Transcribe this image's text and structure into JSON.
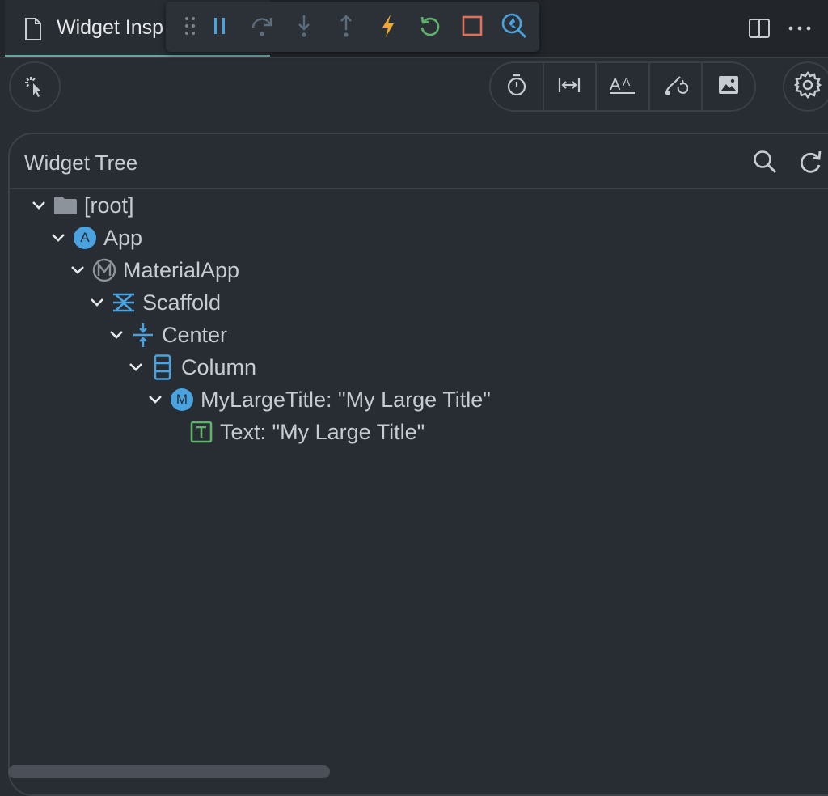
{
  "tab": {
    "label": "Widget Insp"
  },
  "panel": {
    "title": "Widget Tree"
  },
  "tree": [
    {
      "label": "[root]",
      "icon": "folder-icon"
    },
    {
      "label": "App",
      "icon": "app-badge-icon",
      "badge": "A"
    },
    {
      "label": "MaterialApp",
      "icon": "material-app-icon"
    },
    {
      "label": "Scaffold",
      "icon": "scaffold-icon"
    },
    {
      "label": "Center",
      "icon": "center-icon"
    },
    {
      "label": "Column",
      "icon": "column-icon"
    },
    {
      "label": "MyLargeTitle: \"My Large Title\"",
      "icon": "custom-widget-icon",
      "badge": "M"
    },
    {
      "label": "Text: \"My Large Title\"",
      "icon": "text-widget-icon",
      "badge": "T"
    }
  ],
  "colors": {
    "background": "#282d34",
    "accent_blue": "#4aa3df",
    "hot_reload": "#f0a830",
    "restart": "#5fb36a",
    "stop": "#e0705a",
    "text": "#c7ccd2"
  }
}
